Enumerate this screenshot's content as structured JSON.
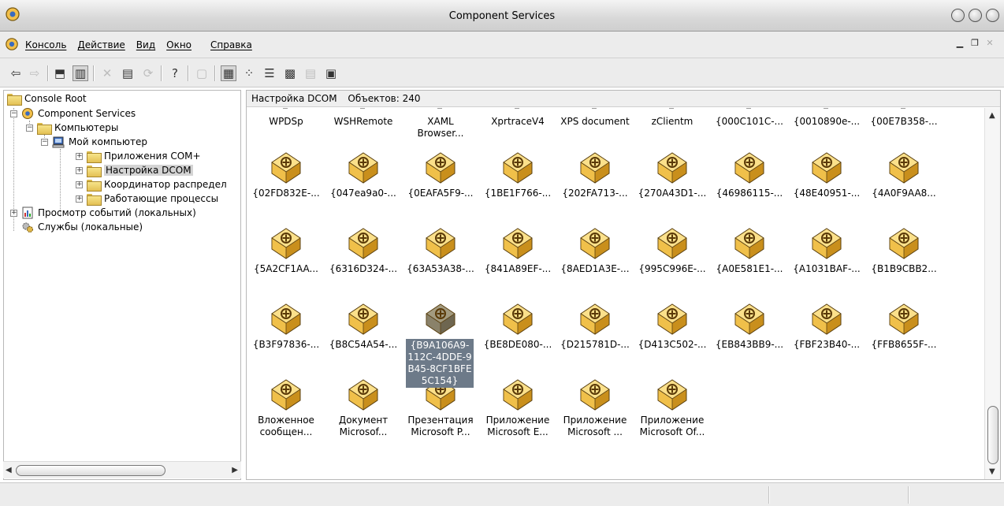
{
  "window": {
    "title": "Component Services"
  },
  "menu": {
    "items": [
      "Консоль",
      "Действие",
      "Вид",
      "Окно",
      "Справка"
    ]
  },
  "toolbar": {
    "buttons": [
      "back-arrow-icon",
      "forward-arrow-icon",
      "up-folder-icon",
      "show-hide-tree-icon",
      "delete-icon",
      "properties-icon",
      "refresh-icon",
      "help-icon",
      "new-window-icon",
      "large-icons-view-icon",
      "small-icons-view-icon",
      "list-view-icon",
      "detail-view-icon",
      "configure-icon",
      "console-icon"
    ]
  },
  "tree": {
    "items": [
      {
        "label": "Console Root",
        "icon": "folder-icon",
        "level": 0
      },
      {
        "label": "Component Services",
        "icon": "component-services-icon",
        "level": 1,
        "expander": "−"
      },
      {
        "label": "Компьютеры",
        "icon": "folder-icon",
        "level": 2,
        "expander": "−"
      },
      {
        "label": "Мой компьютер",
        "icon": "computer-icon",
        "level": 3,
        "expander": "−"
      },
      {
        "label": "Приложения COM+",
        "icon": "folder-icon",
        "level": 4,
        "expander": "+"
      },
      {
        "label": "Настройка DCOM",
        "icon": "folder-open-icon",
        "level": 4,
        "expander": "+",
        "selected": true
      },
      {
        "label": "Координатор распредел",
        "icon": "folder-icon",
        "level": 4,
        "expander": "+"
      },
      {
        "label": "Работающие процессы",
        "icon": "folder-icon",
        "level": 4,
        "expander": "+"
      },
      {
        "label": "Просмотр событий (локальных)",
        "icon": "event-viewer-icon",
        "level": 0,
        "expander": "+"
      },
      {
        "label": "Службы (локальные)",
        "icon": "services-gear-icon",
        "level": 0
      }
    ]
  },
  "content": {
    "header_title": "Настройка DCOM",
    "header_count": "Объектов: 240",
    "top_row": [
      "WPDSp",
      "WSHRemote",
      "XAML Browser...",
      "XprtraceV4",
      "XPS document",
      "zClientm",
      "{000C101C-...",
      "{0010890e-...",
      "{00E7B358-..."
    ],
    "rows": [
      [
        "{02FD832E-...",
        "{047ea9a0-...",
        "{0EAFA5F9-...",
        "{1BE1F766-...",
        "{202FA713-...",
        "{270A43D1-...",
        "{46986115-...",
        "{48E40951-...",
        "{4A0F9AA8..."
      ],
      [
        "{5A2CF1AA...",
        "{6316D324-...",
        "{63A53A38-...",
        "{841A89EF-...",
        "{8AED1A3E-...",
        "{995C996E-...",
        "{A0E581E1-...",
        "{A1031BAF-...",
        "{B1B9CBB2..."
      ],
      [
        "{B3F97836-...",
        "{B8C54A54-...",
        "{B9A106A9-112C-4DDE-9B45-8CF1BFE5C154}",
        "{BE8DE080-...",
        "{D215781D-...",
        "{D413C502-...",
        "{EB843BB9-...",
        "{FBF23B40-...",
        "{FFB8655F-..."
      ],
      [
        "Вложенное сообщен...",
        "Документ Microsof...",
        "Презентация Microsoft P...",
        "Приложение Microsoft E...",
        "Приложение Microsoft ...",
        "Приложение Microsoft Of..."
      ]
    ],
    "selected_item": "{B9A106A9-112C-4DDE-9B45-8CF1BFE5C154}"
  },
  "colors": {
    "selection": "#6d7a89",
    "icon_gold": "#e8b83c"
  }
}
